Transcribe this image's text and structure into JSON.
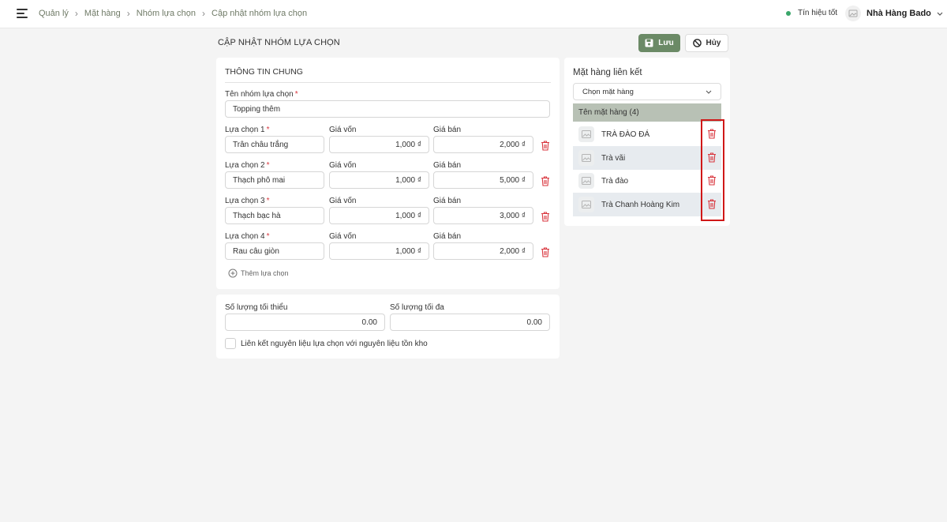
{
  "breadcrumb": [
    "Quản lý",
    "Mặt hàng",
    "Nhóm lựa chọn",
    "Cập nhật nhóm lựa chọn"
  ],
  "header": {
    "signal_text": "Tín hiệu tốt",
    "store_name": "Nhà Hàng Bado"
  },
  "page": {
    "title": "CẬP NHẬT NHÓM LỰA CHỌN",
    "save_label": "Lưu",
    "cancel_label": "Hủy"
  },
  "general": {
    "section_title": "THÔNG TIN CHUNG",
    "group_name_label": "Tên nhóm lựa chọn",
    "group_name_value": "Topping thêm",
    "cost_label": "Giá vốn",
    "price_label": "Giá bán",
    "choices": [
      {
        "label": "Lựa chọn 1",
        "name": "Trân châu trắng",
        "cost": "1,000 ₫",
        "price": "2,000 ₫"
      },
      {
        "label": "Lựa chọn 2",
        "name": "Thạch phô mai",
        "cost": "1,000 ₫",
        "price": "5,000 ₫"
      },
      {
        "label": "Lựa chọn 3",
        "name": "Thạch bạc hà",
        "cost": "1,000 ₫",
        "price": "3,000 ₫"
      },
      {
        "label": "Lựa chọn 4",
        "name": "Rau câu giòn",
        "cost": "1,000 ₫",
        "price": "2,000 ₫"
      }
    ],
    "add_choice_label": "Thêm lựa chọn"
  },
  "quantity": {
    "min_label": "Số lượng tối thiểu",
    "min_value": "0.00",
    "max_label": "Số lượng tối đa",
    "max_value": "0.00",
    "link_checkbox_label": "Liên kết nguyên liệu lựa chọn với nguyên liệu tồn kho",
    "link_checked": false
  },
  "linked": {
    "title": "Mặt hàng liên kết",
    "select_placeholder": "Chọn mặt hàng",
    "column_header": "Tên mặt hàng (4)",
    "items": [
      "TRÀ ĐÀO ĐÁ",
      "Trà vãi",
      "Trà đào",
      "Trà Chanh Hoàng Kim"
    ]
  },
  "colors": {
    "accent": "#6b8a66",
    "danger": "#d9363e",
    "signal": "#3aa66a",
    "highlight": "#d01818"
  }
}
